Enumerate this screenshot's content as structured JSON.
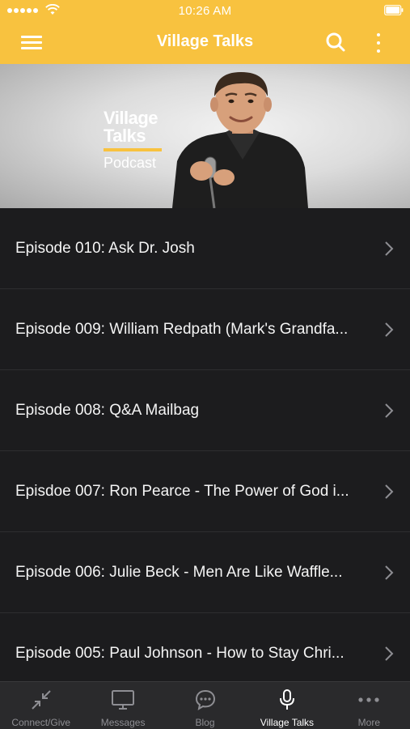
{
  "status_bar": {
    "time": "10:26 AM"
  },
  "nav": {
    "title": "Village Talks"
  },
  "hero": {
    "logo_line1": "Village",
    "logo_line2": "Talks",
    "logo_line3": "Podcast"
  },
  "episodes": [
    {
      "title": "Episode 010: Ask Dr. Josh"
    },
    {
      "title": "Episode 009: William Redpath (Mark's Grandfa..."
    },
    {
      "title": "Episode 008: Q&A Mailbag"
    },
    {
      "title": "Episdoe 007: Ron Pearce - The Power of God i..."
    },
    {
      "title": "Episode 006: Julie Beck - Men Are Like Waffle..."
    },
    {
      "title": "Episode 005: Paul Johnson - How to Stay Chri..."
    }
  ],
  "tabs": [
    {
      "label": "Connect/Give",
      "icon": "compress-arrows-icon"
    },
    {
      "label": "Messages",
      "icon": "monitor-icon"
    },
    {
      "label": "Blog",
      "icon": "chat-bubble-icon"
    },
    {
      "label": "Village Talks",
      "icon": "microphone-icon",
      "active": true
    },
    {
      "label": "More",
      "icon": "more-dots-icon"
    }
  ],
  "colors": {
    "accent": "#f8c23f",
    "background": "#1c1c1e",
    "tab_bar": "#2a2a2c"
  }
}
